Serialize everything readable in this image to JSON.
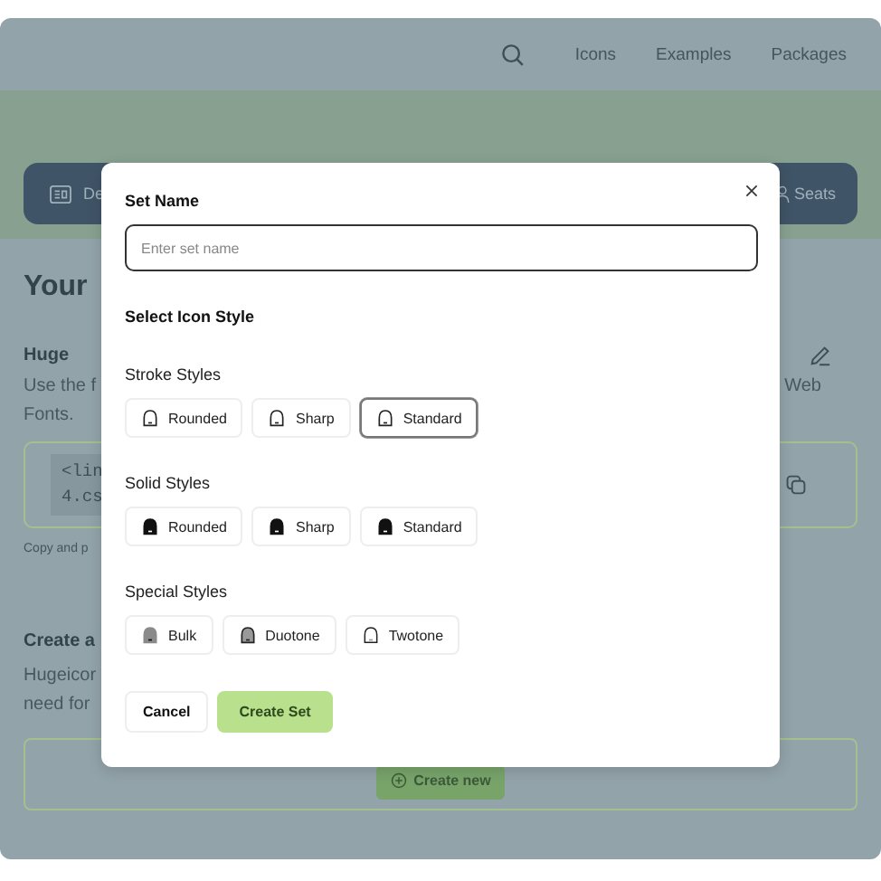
{
  "nav": {
    "links": [
      "Icons",
      "Examples",
      "Packages"
    ]
  },
  "toolbar": {
    "left_label": "De",
    "right_label": "Seats"
  },
  "background": {
    "heading": "Your",
    "section_title": "Huge",
    "text_left": "Use the f",
    "text_right": "Web",
    "text_line2": "Fonts.",
    "code_lines": [
      "<lin",
      "4.cs"
    ],
    "code_note": "Copy and p",
    "create_title": "Create a",
    "create_text_lines": [
      "Hugeicor",
      "need for"
    ],
    "create_button": "Create new"
  },
  "dialog": {
    "name_label": "Set Name",
    "name_placeholder": "Enter set name",
    "style_heading": "Select Icon Style",
    "groups": [
      {
        "title": "Stroke Styles",
        "options": [
          {
            "label": "Rounded",
            "kind": "stroke",
            "selected": false
          },
          {
            "label": "Sharp",
            "kind": "stroke",
            "selected": false
          },
          {
            "label": "Standard",
            "kind": "stroke",
            "selected": true
          }
        ]
      },
      {
        "title": "Solid Styles",
        "options": [
          {
            "label": "Rounded",
            "kind": "solid",
            "selected": false
          },
          {
            "label": "Sharp",
            "kind": "solid",
            "selected": false
          },
          {
            "label": "Standard",
            "kind": "solid",
            "selected": false
          }
        ]
      },
      {
        "title": "Special Styles",
        "options": [
          {
            "label": "Bulk",
            "kind": "bulk",
            "selected": false
          },
          {
            "label": "Duotone",
            "kind": "duotone",
            "selected": false
          },
          {
            "label": "Twotone",
            "kind": "twotone",
            "selected": false
          }
        ]
      }
    ],
    "cancel": "Cancel",
    "create": "Create Set"
  }
}
